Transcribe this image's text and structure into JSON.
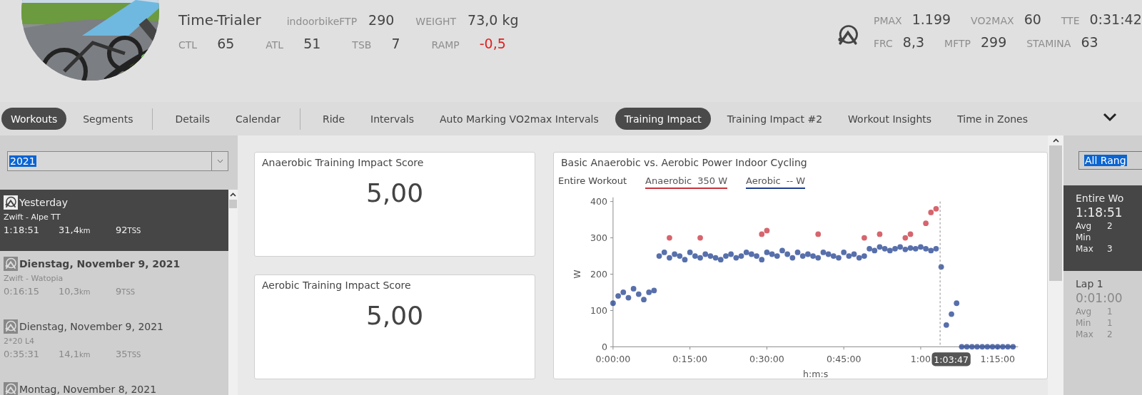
{
  "athlete": {
    "name": "Time-Trialer",
    "stats_row_1": [
      {
        "label": "indoorbikeFTP",
        "value": "290"
      },
      {
        "label": "WEIGHT",
        "value": "73,0 kg"
      }
    ],
    "stats_row_2": [
      {
        "label": "CTL",
        "value": "65",
        "negative": false
      },
      {
        "label": "ATL",
        "value": "51",
        "negative": false
      },
      {
        "label": "TSB",
        "value": "7",
        "negative": false
      },
      {
        "label": "RAMP",
        "value": "-0,5",
        "negative": true
      }
    ]
  },
  "power_profile": {
    "row_1": [
      {
        "label": "PMAX",
        "value": "1.199"
      },
      {
        "label": "VO2MAX",
        "value": "60"
      },
      {
        "label": "TTE",
        "value": "0:31:42"
      }
    ],
    "row_2": [
      {
        "label": "FRC",
        "value": "8,3"
      },
      {
        "label": "MFTP",
        "value": "299"
      },
      {
        "label": "STAMINA",
        "value": "63"
      }
    ]
  },
  "tab_groups": [
    [
      {
        "label": "Workouts",
        "selected": true
      },
      {
        "label": "Segments",
        "selected": false
      }
    ],
    [
      {
        "label": "Details",
        "selected": false
      },
      {
        "label": "Calendar",
        "selected": false
      }
    ],
    [
      {
        "label": "Ride",
        "selected": false
      },
      {
        "label": "Intervals",
        "selected": false
      },
      {
        "label": "Auto Marking VO2max Intervals",
        "selected": false
      },
      {
        "label": "Training Impact",
        "selected": true
      },
      {
        "label": "Training Impact #2",
        "selected": false
      },
      {
        "label": "Workout Insights",
        "selected": false
      },
      {
        "label": "Time in Zones",
        "selected": false
      }
    ]
  ],
  "year_select": {
    "value": "2021"
  },
  "workouts": [
    {
      "title": "Yesterday",
      "subtitle": "Zwift - Alpe TT",
      "duration": "1:18:51",
      "distance": "31,4",
      "distance_unit": "km",
      "tss": "92",
      "tss_unit": "TSS",
      "selected": true,
      "emphasized": false
    },
    {
      "title": "Dienstag, November 9, 2021",
      "subtitle": "Zwift - Watopia",
      "duration": "0:16:15",
      "distance": "10,3",
      "distance_unit": "km",
      "tss": "9",
      "tss_unit": "TSS",
      "selected": false,
      "emphasized": true
    },
    {
      "title": "Dienstag, November 9, 2021",
      "subtitle": "2*20 L4",
      "duration": "0:35:31",
      "distance": "14,1",
      "distance_unit": "km",
      "tss": "35",
      "tss_unit": "TSS",
      "selected": false,
      "emphasized": false
    },
    {
      "title": "Montag, November 8, 2021",
      "selected": false,
      "emphasized": false
    }
  ],
  "score_cards": [
    {
      "title": "Anaerobic Training Impact Score",
      "value": "5,00"
    },
    {
      "title": "Aerobic Training Impact Score",
      "value": "5,00"
    }
  ],
  "chart_card": {
    "title": "Basic Anaerobic vs. Aerobic Power Indoor Cycling",
    "filter": {
      "label": "Entire Workout"
    },
    "legend_readings": [
      "350 W",
      "-- W"
    ],
    "chart_data": {
      "type": "scatter",
      "xlabel": "h:m:s",
      "ylabel": "W",
      "xlim": [
        0,
        4740
      ],
      "ylim": [
        0,
        400
      ],
      "xticks": [
        {
          "value": 0,
          "label": "0:00:00"
        },
        {
          "value": 900,
          "label": "0:15:00"
        },
        {
          "value": 1800,
          "label": "0:30:00"
        },
        {
          "value": 2700,
          "label": "0:45:00"
        },
        {
          "value": 3600,
          "label": "1:00"
        },
        {
          "value": 4500,
          "label": "1:15:00"
        }
      ],
      "yticks": [
        0,
        100,
        200,
        300,
        400
      ],
      "x": [
        0,
        60,
        120,
        180,
        240,
        300,
        360,
        420,
        480,
        540,
        600,
        660,
        720,
        780,
        840,
        900,
        960,
        1020,
        1080,
        1140,
        1200,
        1260,
        1320,
        1380,
        1440,
        1500,
        1560,
        1620,
        1680,
        1740,
        1800,
        1860,
        1920,
        1980,
        2040,
        2100,
        2160,
        2220,
        2280,
        2340,
        2400,
        2460,
        2520,
        2580,
        2640,
        2700,
        2760,
        2820,
        2880,
        2940,
        3000,
        3060,
        3120,
        3180,
        3240,
        3300,
        3360,
        3420,
        3480,
        3540,
        3600,
        3660,
        3720,
        3780,
        3840,
        3900,
        3960,
        4020,
        4080,
        4140,
        4200,
        4260,
        4320,
        4380,
        4440,
        4500,
        4560,
        4620,
        4680
      ],
      "series": [
        {
          "name": "Anaerobic",
          "color": "#c8323c",
          "values": [
            null,
            null,
            null,
            null,
            null,
            null,
            null,
            null,
            null,
            null,
            null,
            300,
            null,
            null,
            null,
            null,
            null,
            300,
            null,
            null,
            null,
            null,
            null,
            null,
            null,
            null,
            null,
            null,
            null,
            310,
            320,
            null,
            null,
            null,
            null,
            null,
            null,
            null,
            null,
            null,
            310,
            null,
            null,
            null,
            null,
            null,
            null,
            null,
            null,
            300,
            null,
            null,
            310,
            null,
            null,
            null,
            null,
            300,
            310,
            null,
            null,
            340,
            370,
            380,
            null,
            null,
            null,
            null,
            null,
            null,
            null,
            null,
            null,
            null,
            null,
            null,
            null,
            null,
            null
          ]
        },
        {
          "name": "Aerobic",
          "color": "#1f3f8f",
          "values": [
            120,
            140,
            150,
            135,
            160,
            145,
            130,
            150,
            155,
            250,
            260,
            245,
            255,
            250,
            240,
            260,
            250,
            245,
            255,
            250,
            245,
            240,
            250,
            255,
            245,
            250,
            260,
            255,
            250,
            240,
            260,
            255,
            250,
            265,
            255,
            245,
            260,
            250,
            255,
            250,
            245,
            260,
            255,
            250,
            245,
            260,
            250,
            255,
            245,
            250,
            270,
            265,
            275,
            270,
            265,
            270,
            275,
            268,
            272,
            270,
            275,
            270,
            265,
            270,
            220,
            60,
            90,
            120,
            0,
            0,
            0,
            0,
            0,
            0,
            0,
            0,
            0,
            0,
            0
          ]
        }
      ],
      "ref_lines": [
        {
          "axis": "x",
          "value": 3827
        }
      ],
      "annotations": [
        {
          "text": "1:03:47"
        }
      ]
    }
  },
  "laps_panel": {
    "range_select": {
      "value": "All Rang"
    },
    "laps": [
      {
        "title": "Entire Wo",
        "duration": "1:18:51",
        "selected": true,
        "rows": [
          {
            "label": "Avg",
            "value": "2"
          },
          {
            "label": "Min"
          },
          {
            "label": "Max",
            "value": "3"
          }
        ]
      },
      {
        "title": "Lap 1",
        "duration": "0:01:00",
        "selected": false,
        "rows": [
          {
            "label": "Avg",
            "value": "1"
          },
          {
            "label": "Min",
            "value": "1"
          },
          {
            "label": "Max",
            "value": "2"
          }
        ]
      }
    ]
  }
}
